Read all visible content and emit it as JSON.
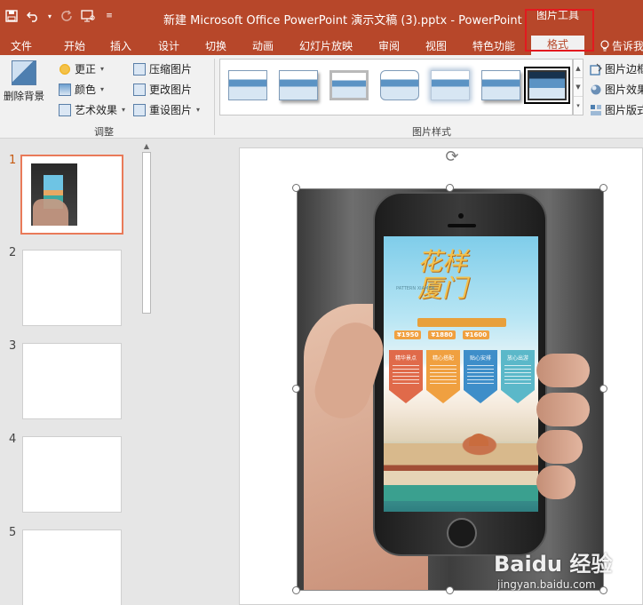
{
  "window": {
    "title": "新建 Microsoft Office PowerPoint 演示文稿 (3).pptx - PowerPoint",
    "context_tool_title": "图片工具",
    "top_right_stub": "新建..."
  },
  "quick_access": {
    "save_icon": "save-icon",
    "undo_icon": "undo-icon",
    "redo_icon": "redo-icon",
    "slideshow_icon": "start-slideshow-icon",
    "customize_icon": "customize-qat-icon"
  },
  "tabs": [
    {
      "label": "文件"
    },
    {
      "label": "开始"
    },
    {
      "label": "插入"
    },
    {
      "label": "设计"
    },
    {
      "label": "切换"
    },
    {
      "label": "动画"
    },
    {
      "label": "幻灯片放映"
    },
    {
      "label": "审阅"
    },
    {
      "label": "视图"
    },
    {
      "label": "特色功能"
    }
  ],
  "active_tab": {
    "label": "格式"
  },
  "tell_me": {
    "label": "告诉我"
  },
  "ribbon": {
    "adjust": {
      "remove_background": "删除背景",
      "corrections": "更正",
      "color": "颜色",
      "artistic_effects": "艺术效果",
      "compress": "压缩图片",
      "change_picture": "更改图片",
      "reset_picture": "重设图片",
      "group_label": "调整"
    },
    "picture_styles": {
      "group_label": "图片样式",
      "selected_index": 6
    },
    "right_items": {
      "border": "图片边框",
      "effects": "图片效果",
      "layout": "图片版式"
    }
  },
  "slides": [
    {
      "number": "1"
    },
    {
      "number": "2"
    },
    {
      "number": "3"
    },
    {
      "number": "4"
    },
    {
      "number": "5"
    }
  ],
  "poster": {
    "title": "花样 厦门",
    "subtitle": "PATTERN XIAMEN",
    "prices": [
      "¥1950",
      "¥1880",
      "¥1600"
    ],
    "cards": [
      "精华景点",
      "精心搭配",
      "贴心安排",
      "放心出游"
    ]
  },
  "watermark": {
    "brand": "Baidu 经验",
    "url": "jingyan.baidu.com"
  },
  "colors": {
    "titlebar": "#b7472a",
    "ribbon": "#f1f1f1",
    "context_highlight": "#e3191f",
    "active_slide_border": "#e97a59"
  }
}
